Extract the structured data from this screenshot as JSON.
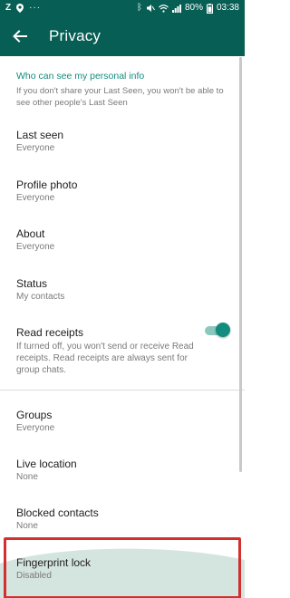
{
  "status_bar": {
    "battery_percent": "80%",
    "time": "03:38",
    "left_icons": [
      "z-icon",
      "location-pin-icon",
      "more-dots-icon"
    ],
    "right_icons": [
      "bluetooth-icon",
      "mute-icon",
      "wifi-icon",
      "signal-icon",
      "battery-icon"
    ]
  },
  "app_bar": {
    "title": "Privacy",
    "back_icon": "arrow-left-icon"
  },
  "section": {
    "heading": "Who can see my personal info",
    "note": "If you don't share your Last Seen, you won't be able to see other people's Last Seen"
  },
  "items": {
    "last_seen": {
      "title": "Last seen",
      "value": "Everyone"
    },
    "profile_photo": {
      "title": "Profile photo",
      "value": "Everyone"
    },
    "about": {
      "title": "About",
      "value": "Everyone"
    },
    "status": {
      "title": "Status",
      "value": "My contacts"
    },
    "read_receipts": {
      "title": "Read receipts",
      "description": "If turned off, you won't send or receive Read receipts. Read receipts are always sent for group chats.",
      "enabled": true
    },
    "groups": {
      "title": "Groups",
      "value": "Everyone"
    },
    "live_location": {
      "title": "Live location",
      "value": "None"
    },
    "blocked_contacts": {
      "title": "Blocked contacts",
      "value": "None"
    },
    "fingerprint_lock": {
      "title": "Fingerprint lock",
      "value": "Disabled"
    }
  },
  "colors": {
    "app_bar": "#075e54",
    "accent": "#128c7e",
    "highlight": "#d32f2f"
  }
}
